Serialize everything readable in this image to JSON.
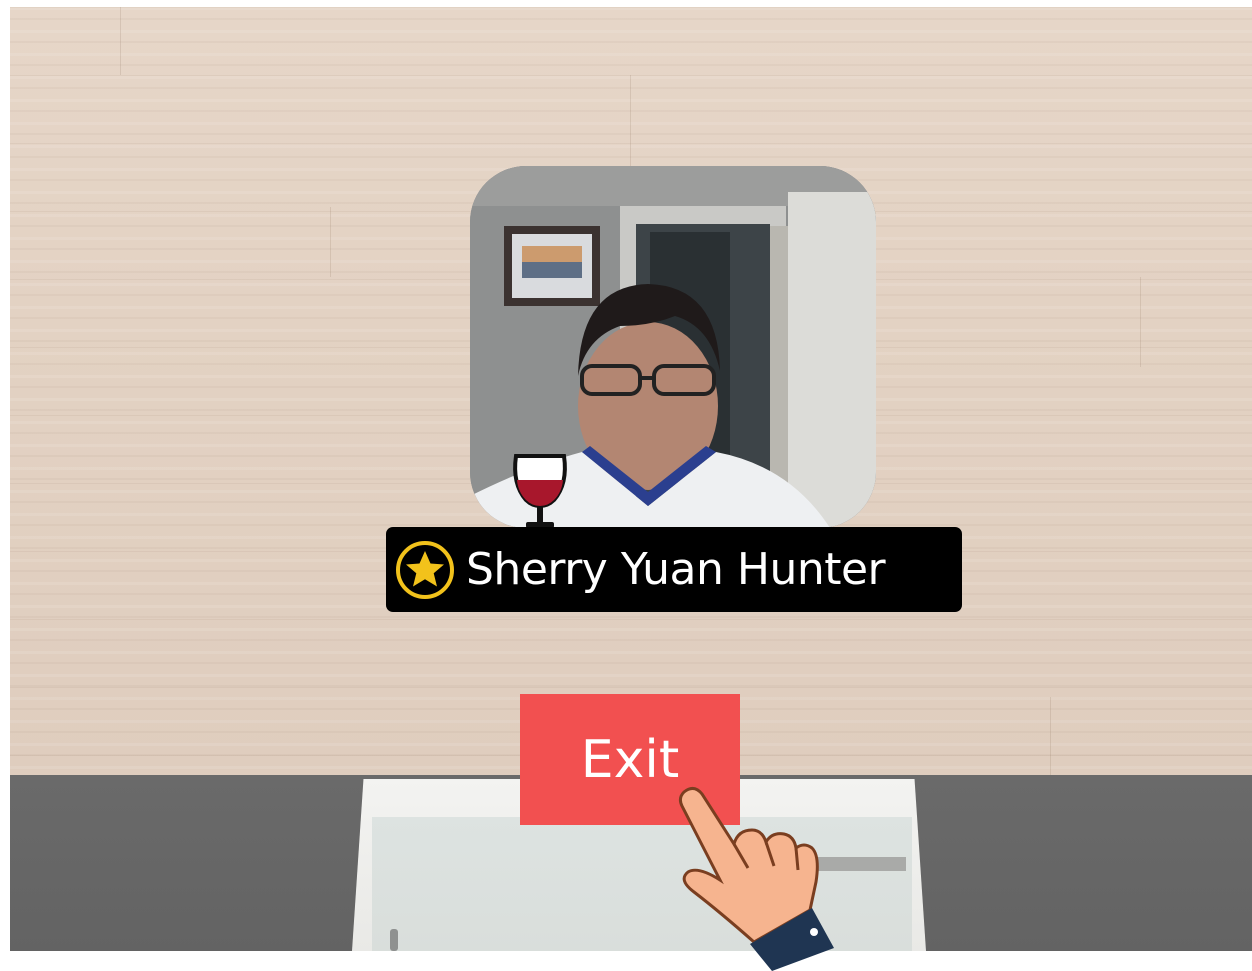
{
  "participant": {
    "name": "Sherry Yuan Hunter",
    "badge_icon": "star-badge-icon",
    "drink_icon": "red-wine-glass-icon"
  },
  "actions": {
    "exit_label": "Exit"
  },
  "icons": {
    "pointer": "pointing-hand-icon"
  },
  "colors": {
    "exit_button": "#f25050",
    "nameplate_bg": "#000000",
    "badge_gold": "#f2c21b",
    "wine_red": "#a8172c",
    "floor": "#666666"
  }
}
